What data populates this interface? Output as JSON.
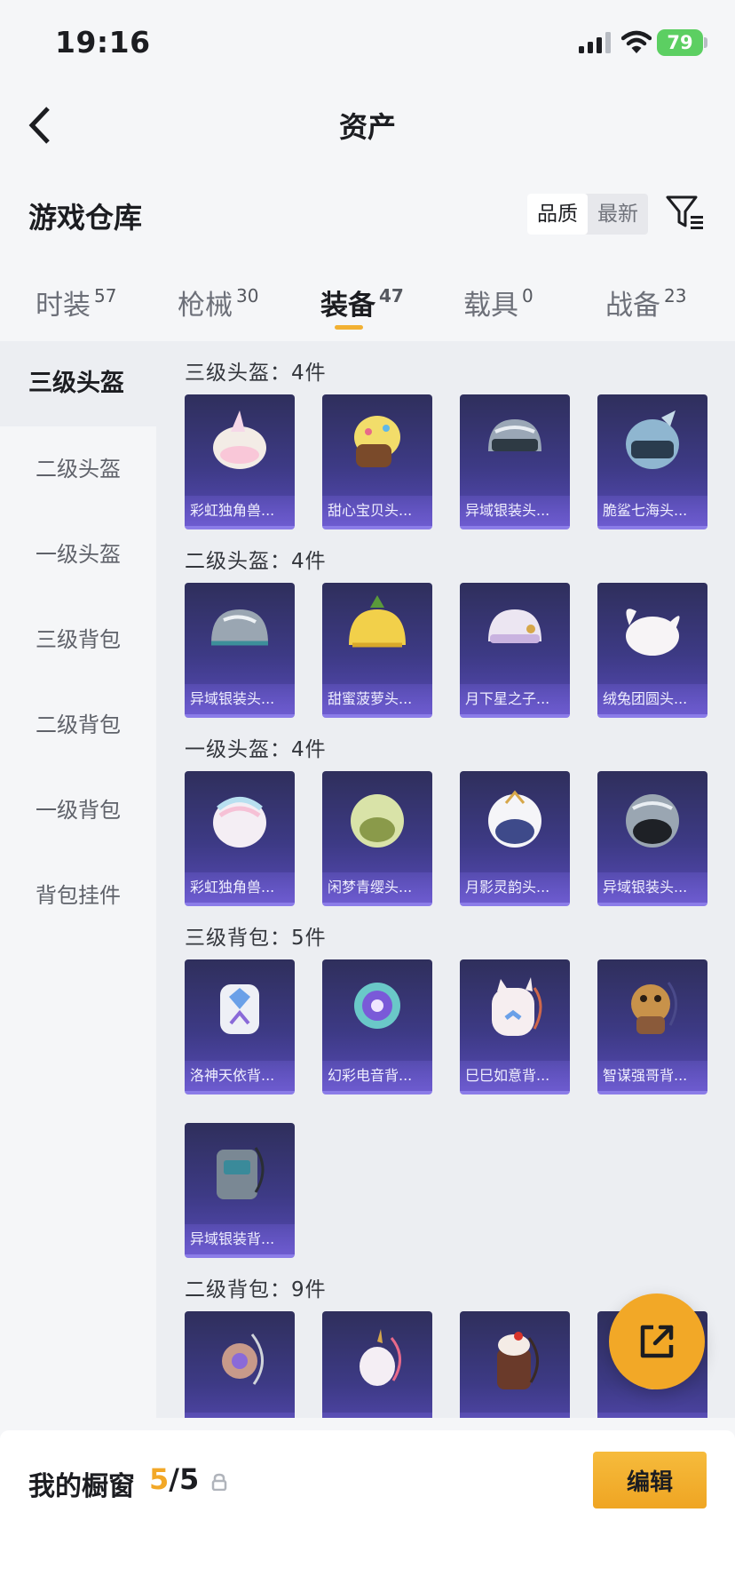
{
  "status_bar": {
    "time": "19:16",
    "battery": "79"
  },
  "header": {
    "title": "资产"
  },
  "section": {
    "title": "游戏仓库",
    "sort_options": [
      "品质",
      "最新"
    ]
  },
  "tabs": [
    {
      "label": "时装",
      "count": "57"
    },
    {
      "label": "枪械",
      "count": "30"
    },
    {
      "label": "装备",
      "count": "47",
      "active": true
    },
    {
      "label": "载具",
      "count": "0"
    },
    {
      "label": "战备",
      "count": "23"
    }
  ],
  "sidebar": {
    "items": [
      "三级头盔",
      "二级头盔",
      "一级头盔",
      "三级背包",
      "二级背包",
      "一级背包",
      "背包挂件"
    ]
  },
  "groups": [
    {
      "title": "三级头盔：4件",
      "items": [
        "彩虹独角兽...",
        "甜心宝贝头...",
        "异域银装头...",
        "脆鲨七海头..."
      ]
    },
    {
      "title": "二级头盔：4件",
      "items": [
        "异域银装头...",
        "甜蜜菠萝头...",
        "月下星之子...",
        "绒兔团圆头..."
      ]
    },
    {
      "title": "一级头盔：4件",
      "items": [
        "彩虹独角兽...",
        "闲梦青缨头...",
        "月影灵韵头...",
        "异域银装头..."
      ]
    },
    {
      "title": "三级背包：5件",
      "items": [
        "洛神天依背...",
        "幻彩电音背...",
        "巳巳如意背...",
        "智谋强哥背...",
        "异域银装背..."
      ]
    },
    {
      "title": "二级背包：9件",
      "items": [
        "",
        "",
        "",
        ""
      ]
    }
  ],
  "bottom_bar": {
    "label": "我的橱窗",
    "current": "5",
    "total": "/5",
    "edit_label": "编辑"
  },
  "colors": {
    "accent": "#f2a827",
    "card_bg": "#3d3a85",
    "card_border": "#8b7ce8"
  }
}
